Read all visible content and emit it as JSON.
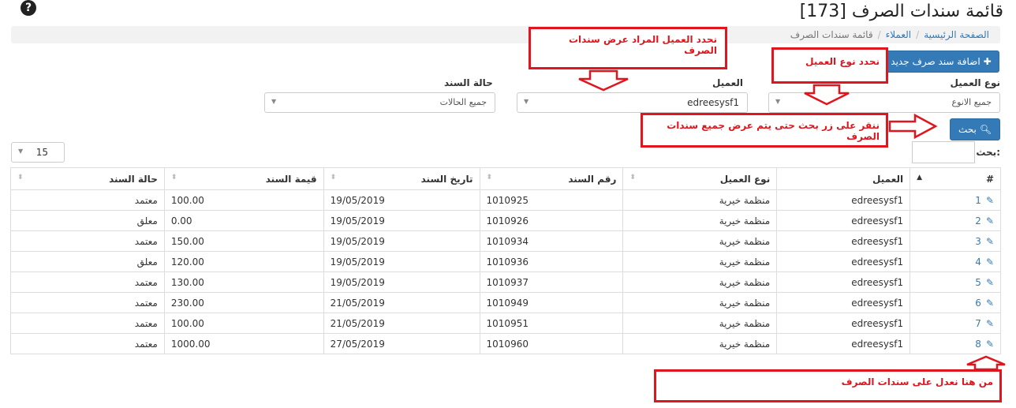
{
  "page": {
    "title": "قائمة سندات الصرف [173]",
    "help_icon": "?"
  },
  "breadcrumb": {
    "home": "الصفحة الرئيسية",
    "customers": "العملاء",
    "current": "قائمة سندات الصرف"
  },
  "toolbar": {
    "add_label": "اضافة سند صرف جديد",
    "search_label": "بحث"
  },
  "filters": {
    "customer_type_label": "نوع العميل",
    "customer_type_value": "جميع الانوع",
    "customer_label": "العميل",
    "customer_value": "edreesysf1",
    "status_label": "حالة السند",
    "status_value": "جميع الحالات"
  },
  "list_controls": {
    "search_label": "بحث:",
    "page_size": "15"
  },
  "table": {
    "headers": [
      "#",
      "العميل",
      "نوع العميل",
      "رقم السند",
      "تاريخ السند",
      "قيمة السند",
      "حالة السند"
    ],
    "rows": [
      {
        "n": "1",
        "customer": "edreesysf1",
        "type": "منظمة خيرية",
        "no": "1010925",
        "date": "19/05/2019",
        "amount": "100.00",
        "status": "معتمد"
      },
      {
        "n": "2",
        "customer": "edreesysf1",
        "type": "منظمة خيرية",
        "no": "1010926",
        "date": "19/05/2019",
        "amount": "0.00",
        "status": "معلق"
      },
      {
        "n": "3",
        "customer": "edreesysf1",
        "type": "منظمة خيرية",
        "no": "1010934",
        "date": "19/05/2019",
        "amount": "150.00",
        "status": "معتمد"
      },
      {
        "n": "4",
        "customer": "edreesysf1",
        "type": "منظمة خيرية",
        "no": "1010936",
        "date": "19/05/2019",
        "amount": "120.00",
        "status": "معلق"
      },
      {
        "n": "5",
        "customer": "edreesysf1",
        "type": "منظمة خيرية",
        "no": "1010937",
        "date": "19/05/2019",
        "amount": "130.00",
        "status": "معتمد"
      },
      {
        "n": "6",
        "customer": "edreesysf1",
        "type": "منظمة خيرية",
        "no": "1010949",
        "date": "21/05/2019",
        "amount": "230.00",
        "status": "معتمد"
      },
      {
        "n": "7",
        "customer": "edreesysf1",
        "type": "منظمة خيرية",
        "no": "1010951",
        "date": "21/05/2019",
        "amount": "100.00",
        "status": "معتمد"
      },
      {
        "n": "8",
        "customer": "edreesysf1",
        "type": "منظمة خيرية",
        "no": "1010960",
        "date": "27/05/2019",
        "amount": "1000.00",
        "status": "معتمد"
      }
    ]
  },
  "annotations": {
    "select_customer": "نحدد العميل المراد عرض سندات الصرف",
    "select_type": "نحدد نوع العميل",
    "click_search": "ننقر على زر بحث حتى يتم عرض جميع سندات الصرف",
    "edit_here": "من هنا نعدل على سندات الصرف"
  },
  "colors": {
    "accent": "#337ab7",
    "annotation": "#e0151d"
  }
}
